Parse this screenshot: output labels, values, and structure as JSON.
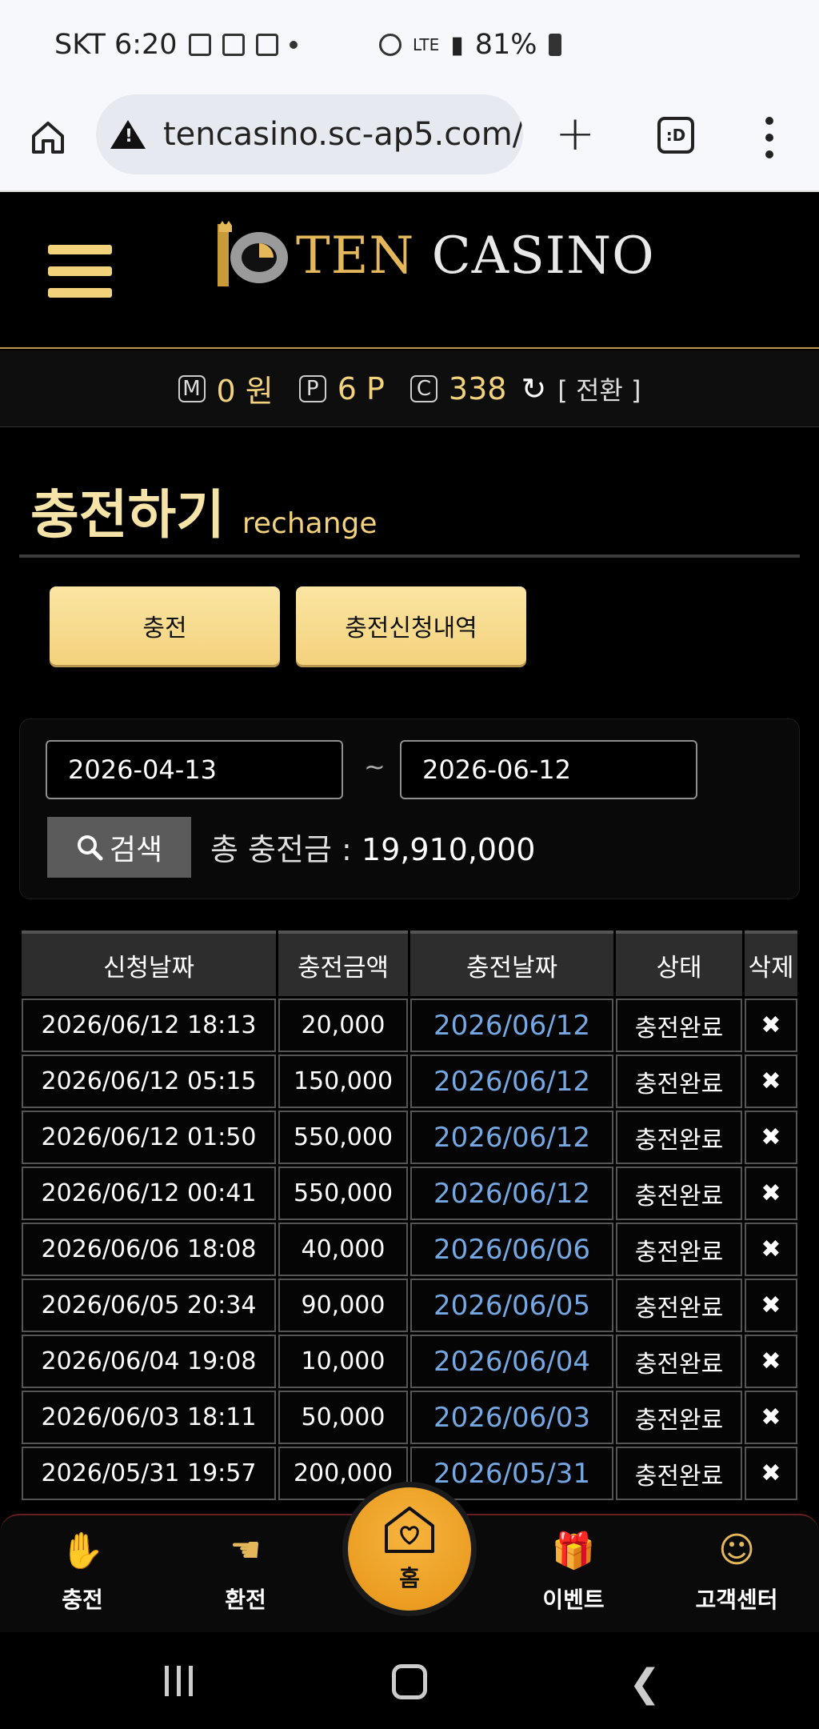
{
  "status_bar": {
    "carrier_time": "SKT 6:20",
    "battery": "81%"
  },
  "browser": {
    "url": "tencasino.sc-ap5.com/",
    "tabs_icon_label": ":D"
  },
  "brand": {
    "ten": "TEN",
    "casino": "CASINO"
  },
  "balance": {
    "money_badge": "M",
    "money": "0 원",
    "point_badge": "P",
    "point": "6 P",
    "coin_badge": "C",
    "coin": "338",
    "switch_label": "[ 전환 ]"
  },
  "page": {
    "title_ko": "충전하기",
    "title_en": "rechange"
  },
  "tabs": {
    "charge": "충전",
    "history": "충전신청내역"
  },
  "search": {
    "date_from": "2026-04-13",
    "tilde": "~",
    "date_to": "2026-06-12",
    "button_label": "검색",
    "total_label": "총 충전금 : ",
    "total_value": "19,910,000"
  },
  "table": {
    "headers": [
      "신청날짜",
      "충전금액",
      "충전날짜",
      "상태",
      "삭제"
    ],
    "rows": [
      {
        "requested": "2026/06/12 18:13",
        "amount": "20,000",
        "charged": "2026/06/12",
        "status": "충전완료",
        "delete": "✖"
      },
      {
        "requested": "2026/06/12 05:15",
        "amount": "150,000",
        "charged": "2026/06/12",
        "status": "충전완료",
        "delete": "✖"
      },
      {
        "requested": "2026/06/12 01:50",
        "amount": "550,000",
        "charged": "2026/06/12",
        "status": "충전완료",
        "delete": "✖"
      },
      {
        "requested": "2026/06/12 00:41",
        "amount": "550,000",
        "charged": "2026/06/12",
        "status": "충전완료",
        "delete": "✖"
      },
      {
        "requested": "2026/06/06 18:08",
        "amount": "40,000",
        "charged": "2026/06/06",
        "status": "충전완료",
        "delete": "✖"
      },
      {
        "requested": "2026/06/05 20:34",
        "amount": "90,000",
        "charged": "2026/06/05",
        "status": "충전완료",
        "delete": "✖"
      },
      {
        "requested": "2026/06/04 19:08",
        "amount": "10,000",
        "charged": "2026/06/04",
        "status": "충전완료",
        "delete": "✖"
      },
      {
        "requested": "2026/06/03 18:11",
        "amount": "50,000",
        "charged": "2026/06/03",
        "status": "충전완료",
        "delete": "✖"
      },
      {
        "requested": "2026/05/31 19:57",
        "amount": "200,000",
        "charged": "2026/05/31",
        "status": "충전완료",
        "delete": "✖"
      }
    ]
  },
  "bottom_nav": {
    "charge": "충전",
    "exchange": "환전",
    "home": "홈",
    "event": "이벤트",
    "support": "고객센터"
  },
  "colors": {
    "gold": "#f3d27d",
    "link_blue": "#75a8e3",
    "home_orange": "#f0a22a"
  }
}
